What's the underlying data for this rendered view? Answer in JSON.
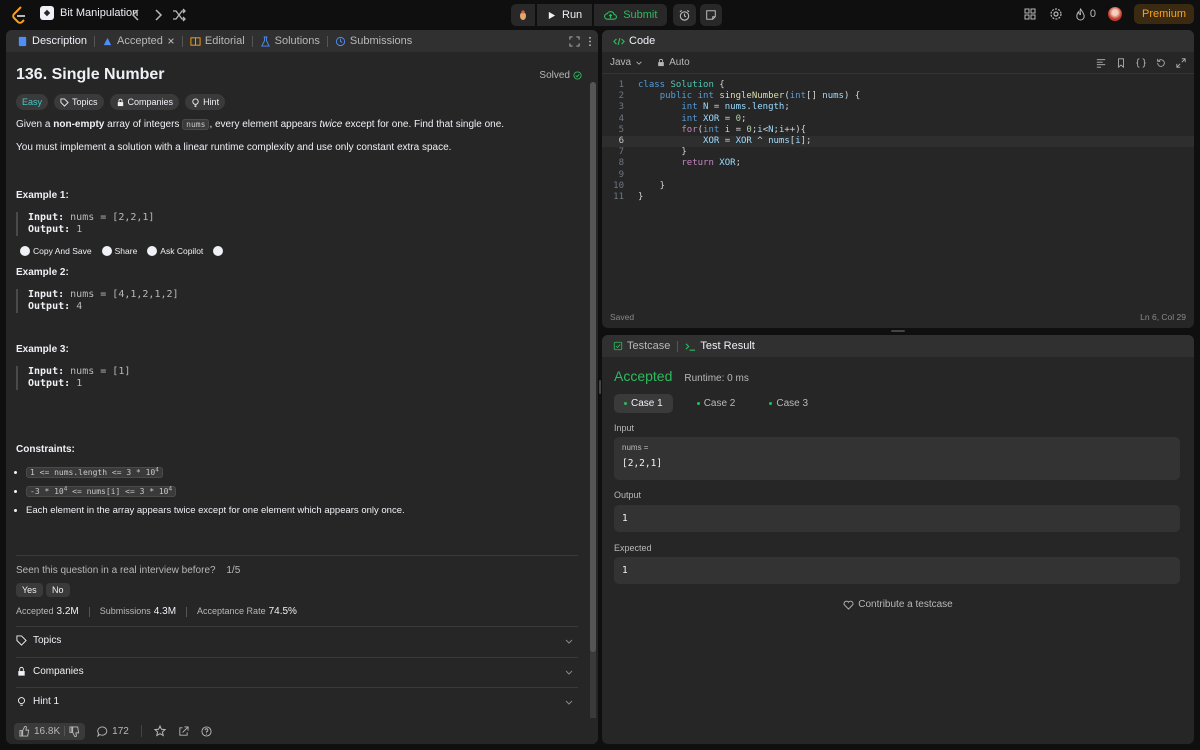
{
  "topbar": {
    "problem_list": "Bit Manipulation",
    "run": "Run",
    "submit": "Submit",
    "streak": "0",
    "premium": "Premium"
  },
  "left": {
    "tabs": [
      "Description",
      "Accepted",
      "Editorial",
      "Solutions",
      "Submissions"
    ],
    "title": "136. Single Number",
    "solved": "Solved",
    "chips": [
      "Easy",
      "Topics",
      "Companies",
      "Hint"
    ],
    "desc1_a": "Given a ",
    "desc1_b": "non-empty",
    "desc1_c": " array of integers ",
    "desc1_code": "nums",
    "desc1_d": ", every element appears ",
    "desc1_e": "twice",
    "desc1_f": " except for one. Find that single one.",
    "desc2": "You must implement a solution with a linear runtime complexity and use only constant extra space.",
    "examples": [
      {
        "title": "Example 1:",
        "input": "nums = [2,2,1]",
        "output": "1"
      },
      {
        "title": "Example 2:",
        "input": "nums = [4,1,2,1,2]",
        "output": "4"
      },
      {
        "title": "Example 3:",
        "input": "nums = [1]",
        "output": "1"
      }
    ],
    "input_label": "Input:",
    "output_label": "Output:",
    "actions": [
      "Copy And Save",
      "Share",
      "Ask Copilot"
    ],
    "constraints_title": "Constraints:",
    "constraints": [
      "1 <= nums.length <= 3 * 10",
      "-3 * 10",
      " <= nums[i] <= 3 * 10",
      "Each element in the array appears twice except for one element which appears only once."
    ],
    "sup": "4",
    "seen_q": "Seen this question in a real interview before?",
    "seen_count": "1/5",
    "yes": "Yes",
    "no": "No",
    "stats": {
      "accepted_label": "Accepted",
      "accepted": "3.2M",
      "submissions_label": "Submissions",
      "submissions": "4.3M",
      "rate_label": "Acceptance Rate",
      "rate": "74.5%"
    },
    "accordions": [
      "Topics",
      "Companies",
      "Hint 1"
    ],
    "likes": "16.8K",
    "comments": "172"
  },
  "code": {
    "title": "Code",
    "language": "Java",
    "mode": "Auto",
    "status": "Saved",
    "cursor": "Ln 6, Col 29"
  },
  "test": {
    "tabs": [
      "Testcase",
      "Test Result"
    ],
    "accepted": "Accepted",
    "runtime": "Runtime: 0 ms",
    "cases": [
      "Case 1",
      "Case 2",
      "Case 3"
    ],
    "input_label": "Input",
    "input_var": "nums =",
    "input_value": "[2,2,1]",
    "output_label": "Output",
    "output_value": "1",
    "expected_label": "Expected",
    "expected_value": "1",
    "contribute": "Contribute a testcase"
  },
  "colors": {
    "accent_green": "#2cbb5d",
    "easy": "#46c6c2",
    "premium": "#ffa116"
  }
}
